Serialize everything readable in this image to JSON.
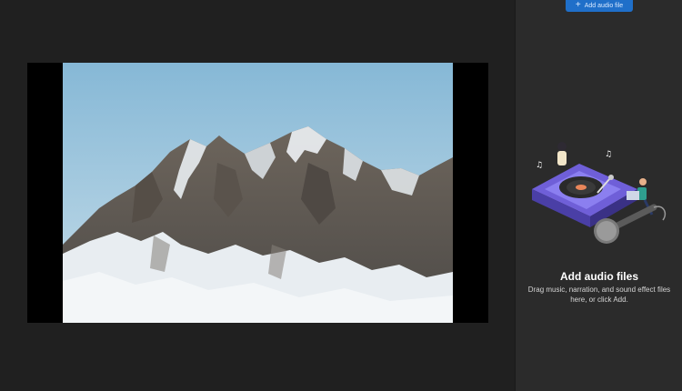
{
  "toolbar": {
    "add_audio_label": "Add audio file",
    "add_icon": "plus-icon"
  },
  "preview": {
    "image_subject": "snowy mountain peak under blue sky"
  },
  "audio_panel": {
    "illustration": "dj-turntable-illustration",
    "title": "Add audio files",
    "description": "Drag music, narration, and sound effect files here, or click Add."
  },
  "colors": {
    "background": "#202020",
    "panel": "#2b2b2b",
    "accent": "#1f6fc9",
    "sky_top": "#8fbfd9",
    "sky_bottom": "#c3dbe8"
  }
}
